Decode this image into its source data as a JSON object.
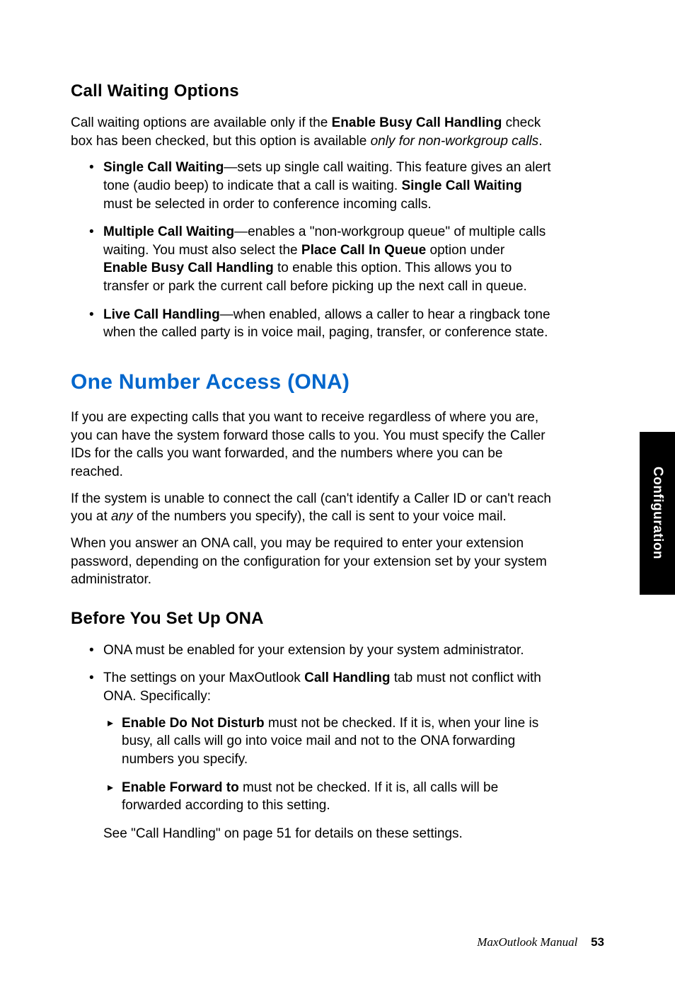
{
  "sidebar": {
    "label": "Configuration"
  },
  "sec1": {
    "heading": "Call Waiting Options",
    "intro_parts": {
      "t1": "Call waiting options are available only if the ",
      "b1": "Enable Busy Call Handling",
      "t2": " check box has been checked, but this option is available ",
      "i1": "only for non-workgroup calls",
      "t3": "."
    },
    "bullets": [
      {
        "b1": "Single Call Waiting",
        "t1": "—sets up single call waiting. This feature gives an alert tone (audio beep) to indicate that a call is waiting. ",
        "b2": "Single Call Waiting",
        "t2": " must be selected in order to conference incoming calls."
      },
      {
        "b1": "Multiple Call Waiting",
        "t1": "—enables a \"non-workgroup queue\" of multiple calls waiting. You must also select the ",
        "b2": "Place Call In Queue",
        "t2": " option under ",
        "b3": "Enable Busy Call Handling",
        "t3": " to enable this option. This allows you to transfer or park the current call before picking up the next call in queue."
      },
      {
        "b1": "Live Call Handling",
        "t1": "—when enabled, allows a caller to hear a ringback tone when the called party is in voice mail, paging, transfer, or conference state."
      }
    ]
  },
  "sec2": {
    "heading": "One Number Access (ONA)",
    "p1": "If you are expecting calls that you want to receive regardless of where you are, you can have the system forward those calls to you. You must specify the Caller IDs for the calls you want forwarded, and the numbers where you can be reached.",
    "p2_parts": {
      "t1": "If the system is unable to connect the call (can't identify a Caller ID or can't reach you at ",
      "i1": "any",
      "t2": " of the numbers you specify), the call is sent to your voice mail."
    },
    "p3": "When you answer an ONA call, you may be required to enter your extension password, depending on the configuration for your extension set by your system administrator."
  },
  "sec3": {
    "heading": "Before You Set Up ONA",
    "bullets": [
      {
        "t1": "ONA must be enabled for your extension by your system administrator."
      },
      {
        "t1": "The settings on your MaxOutlook ",
        "b1": "Call Handling",
        "t2": " tab must not conflict with ONA. Specifically:",
        "sub": [
          {
            "b1": "Enable Do Not Disturb",
            "t1": " must not be checked. If it is, when your line is busy, all calls will go into voice mail and not to the ONA forwarding numbers you specify."
          },
          {
            "b1": "Enable Forward to",
            "t1": " must not be checked. If it is, all calls will be forwarded according to this setting."
          }
        ],
        "after": "See \"Call Handling\" on page 51 for details on these settings."
      }
    ]
  },
  "footer": {
    "title": "MaxOutlook Manual",
    "page": "53"
  }
}
